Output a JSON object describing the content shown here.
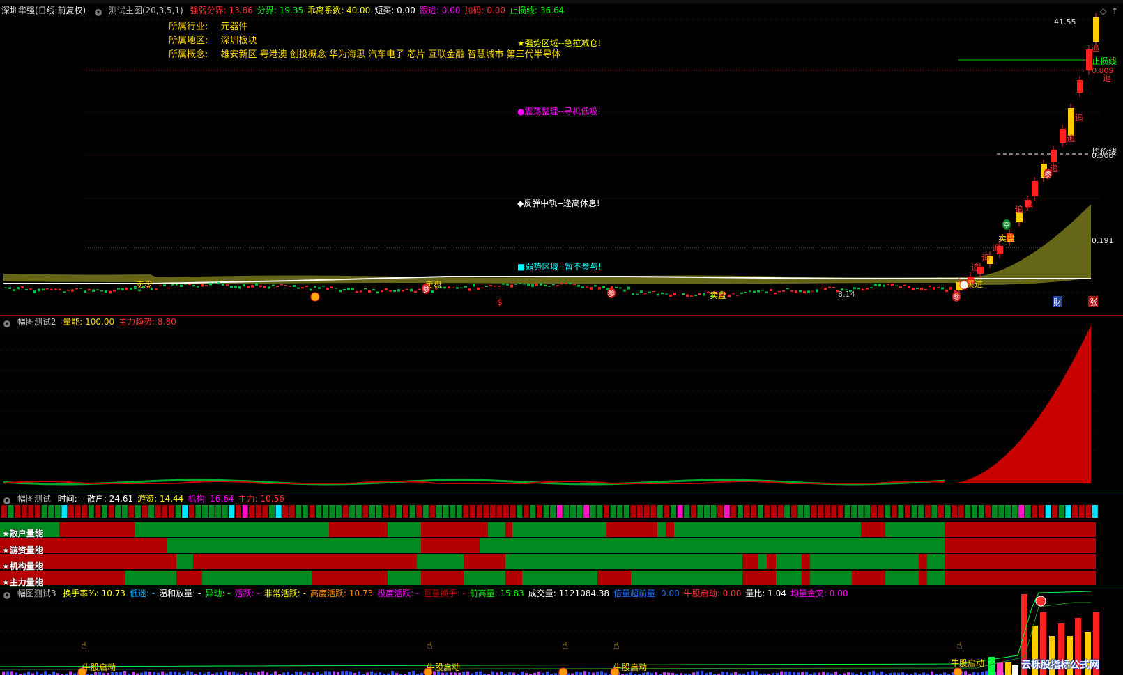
{
  "main_panel": {
    "stock_name": "深圳华强(日线 前复权)",
    "indicator": "测试主图(20,3,5,1)",
    "params": [
      {
        "label": "强弱分界:",
        "value": "13.86",
        "color": "#ff3030"
      },
      {
        "label": "分界:",
        "value": "19.35",
        "color": "#00ff00"
      },
      {
        "label": "乖离系数:",
        "value": "40.00",
        "color": "#ffff00"
      },
      {
        "label": "短买:",
        "value": "0.00",
        "color": "#ffffff"
      },
      {
        "label": "跟进:",
        "value": "0.00",
        "color": "#ff00ff"
      },
      {
        "label": "加码:",
        "value": "0.00",
        "color": "#ff3030"
      },
      {
        "label": "止损线:",
        "value": "36.64",
        "color": "#00ff00"
      }
    ],
    "industry_label": "所属行业:",
    "industry_value": "元器件",
    "region_label": "所属地区:",
    "region_value": "深圳板块",
    "concept_label": "所属概念:",
    "concept_value": "雄安新区 粤港澳 创投概念 华为海思 汽车电子 芯片 互联金融 智慧城市 第三代半导体",
    "zones": [
      {
        "text": "★强势区域--急拉减仓!",
        "color": "#ffff00"
      },
      {
        "text": "●震荡整理--寻机低吸!",
        "color": "#ff00ff"
      },
      {
        "text": "◆反弹中轨--逢高休息!",
        "color": "#ffffff"
      },
      {
        "text": "■弱势区域--暂不参与!",
        "color": "#00ffff"
      }
    ],
    "price_labels": {
      "high": "41.55",
      "stop": "止损线",
      "r1": "0.809",
      "mid": "均价线",
      "r2": "0.500",
      "r3": "0.191",
      "low": "8.14"
    },
    "signals": {
      "chase": "追",
      "join": "参",
      "empty": "空",
      "sell": "卖盘",
      "buy": "买进",
      "dollar": "$",
      "wealth": "财",
      "rise": "涨",
      "diamond_icon": "◇",
      "arrow_icon": "↑"
    }
  },
  "panel2": {
    "title": "幅图测试2",
    "params": [
      {
        "label": "量能:",
        "value": "100.00",
        "color": "#ffd700"
      },
      {
        "label": "主力趋势:",
        "value": "8.80",
        "color": "#ff3030"
      }
    ]
  },
  "panel3": {
    "title": "幅图测试",
    "params": [
      {
        "label": "时间:",
        "value": "-",
        "color": "#ffffff"
      },
      {
        "label": "散户:",
        "value": "24.61",
        "color": "#ffffff"
      },
      {
        "label": "游资:",
        "value": "14.44",
        "color": "#ffff00"
      },
      {
        "label": "机构:",
        "value": "16.64",
        "color": "#ff00ff"
      },
      {
        "label": "主力:",
        "value": "10.56",
        "color": "#ff3030"
      }
    ],
    "rows": [
      "★散户量能",
      "★游资量能",
      "★机构量能",
      "★主力量能"
    ]
  },
  "panel4": {
    "title": "幅图测试3",
    "params": [
      {
        "label": "换手率%:",
        "value": "10.73",
        "color": "#ffff00"
      },
      {
        "label": "低迷:",
        "value": "-",
        "color": "#00aaff"
      },
      {
        "label": "温和放量:",
        "value": "-",
        "color": "#ffffff"
      },
      {
        "label": "异动:",
        "value": "-",
        "color": "#00ff00"
      },
      {
        "label": "活跃:",
        "value": "-",
        "color": "#ff00ff"
      },
      {
        "label": "非常活跃:",
        "value": "-",
        "color": "#ffff00"
      },
      {
        "label": "高度活跃:",
        "value": "10.73",
        "color": "#ff8c00"
      },
      {
        "label": "极度活跃:",
        "value": "-",
        "color": "#ff00ff"
      },
      {
        "label": "巨量换手:",
        "value": "-",
        "color": "#cc0000"
      },
      {
        "label": "前高量:",
        "value": "15.83",
        "color": "#00ff00"
      },
      {
        "label": "成交量:",
        "value": "1121084.38",
        "color": "#ffffff"
      },
      {
        "label": "倍量超前量:",
        "value": "0.00",
        "color": "#1e6fff"
      },
      {
        "label": "牛股启动:",
        "value": "0.00",
        "color": "#ff3030"
      },
      {
        "label": "量比:",
        "value": "1.04",
        "color": "#ffffff"
      },
      {
        "label": "均量金叉:",
        "value": "0.00",
        "color": "#ff00ff"
      }
    ],
    "bull_label": "牛股启动",
    "watermark": "云栎股指标公式网"
  }
}
